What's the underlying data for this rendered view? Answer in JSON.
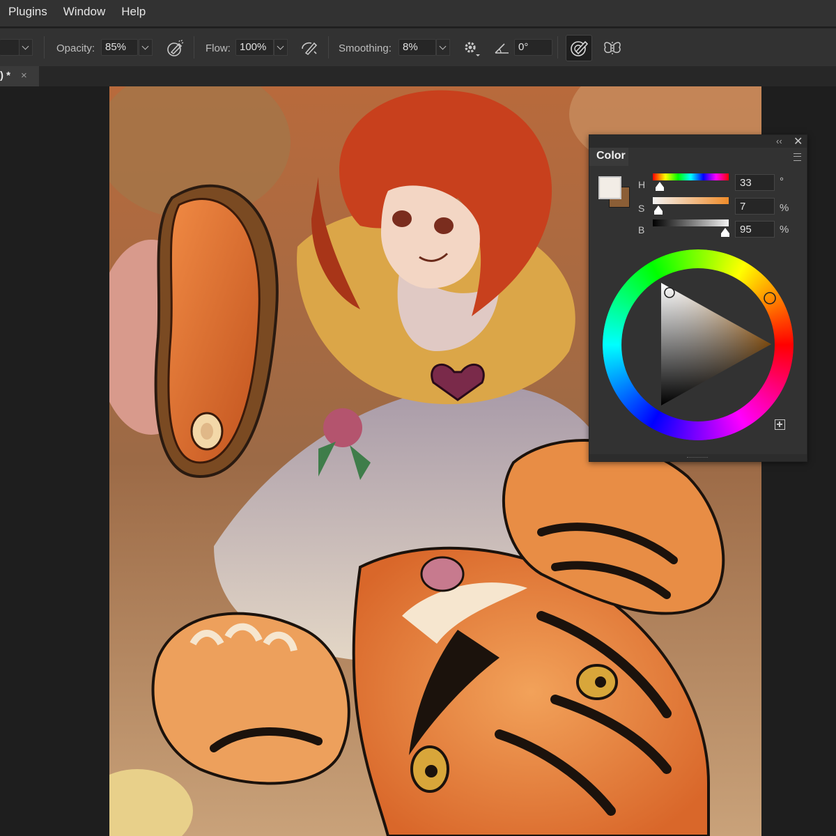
{
  "menu": [
    "Plugins",
    "Window",
    "Help"
  ],
  "options": {
    "opacity_label": "Opacity:",
    "opacity_value": "85%",
    "flow_label": "Flow:",
    "flow_value": "100%",
    "smoothing_label": "Smoothing:",
    "smoothing_value": "8%",
    "angle_value": "0°"
  },
  "tab": {
    "title": ") *",
    "close": "×"
  },
  "color_panel": {
    "title": "Color",
    "h_label": "H",
    "h_value": "33",
    "h_unit": "°",
    "s_label": "S",
    "s_value": "7",
    "s_unit": "%",
    "b_label": "B",
    "b_value": "95",
    "b_unit": "%",
    "foreground_color": "#f2ede6",
    "background_color": "#8b5e36",
    "h_level": 0.09,
    "s_level": 0.07,
    "b_level": 0.95
  },
  "icons": {
    "airbrush": "airbrush-icon",
    "brush_pressure": "pressure-icon",
    "settings": "gear-icon",
    "angle": "angle-icon",
    "size_pressure": "size-pressure-icon",
    "symmetry": "butterfly-icon"
  }
}
